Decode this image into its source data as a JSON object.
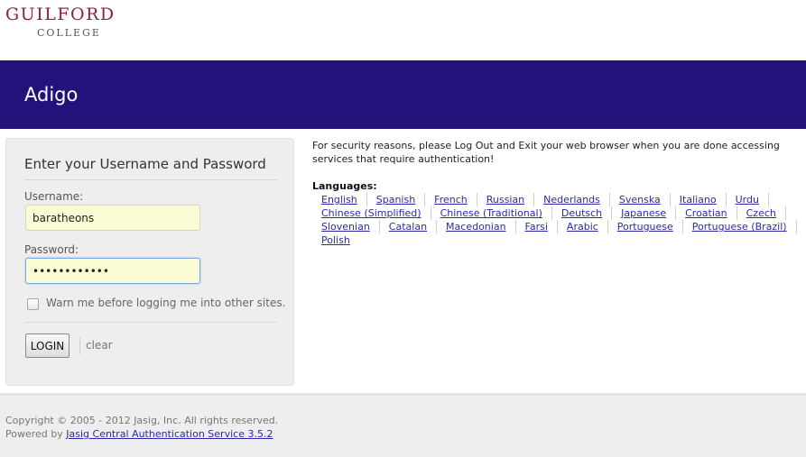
{
  "brand": {
    "logo_main": "GUILFORD",
    "logo_sub": "COLLEGE",
    "accent_color": "#8e2235"
  },
  "header": {
    "title": "Adigo",
    "background_color": "#23127a"
  },
  "login": {
    "heading": "Enter your Username and Password",
    "username_label": "Username:",
    "username_value": "baratheons",
    "password_label": "Password:",
    "password_value": "••••••••••••",
    "warn_label": "Warn me before logging me into other sites.",
    "warn_checked": false,
    "login_button": "LOGIN",
    "clear_link": "clear"
  },
  "info": {
    "security_message": "For security reasons, please Log Out and Exit your web browser when you are done accessing services that require authentication!",
    "languages_title": "Languages:",
    "languages": [
      "English",
      "Spanish",
      "French",
      "Russian",
      "Nederlands",
      "Svenska",
      "Italiano",
      "Urdu",
      "Chinese (Simplified)",
      "Chinese (Traditional)",
      "Deutsch",
      "Japanese",
      "Croatian",
      "Czech",
      "Slovenian",
      "Catalan",
      "Macedonian",
      "Farsi",
      "Arabic",
      "Portuguese",
      "Portuguese (Brazil)",
      "Polish"
    ]
  },
  "footer": {
    "copyright": "Copyright © 2005 - 2012 Jasig, Inc. All rights reserved.",
    "powered_prefix": "Powered by ",
    "powered_link": "Jasig Central Authentication Service 3.5.2"
  }
}
